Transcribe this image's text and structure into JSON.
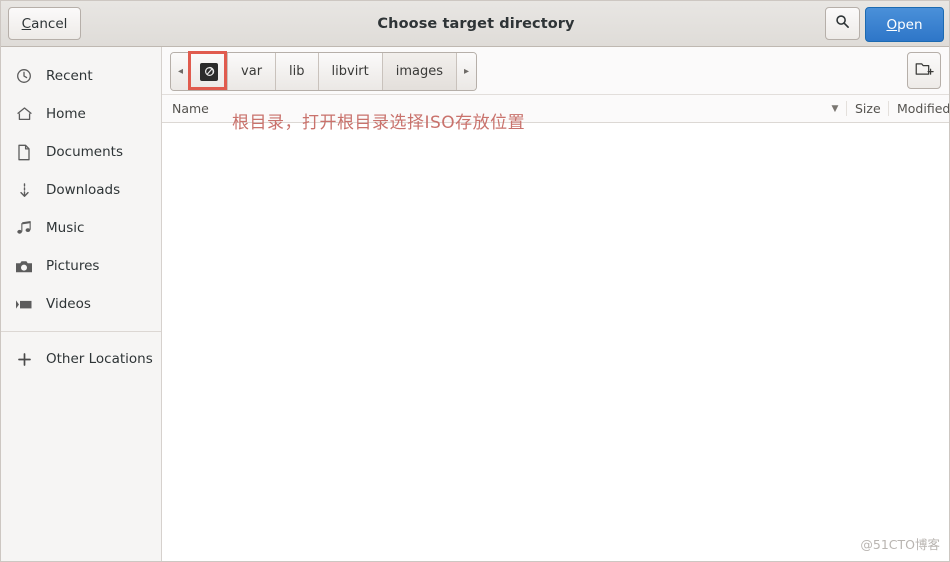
{
  "window": {
    "title": "Choose target directory"
  },
  "header": {
    "cancel_label": "Cancel",
    "cancel_accel": "C",
    "cancel_rest": "ancel",
    "open_label": "Open",
    "open_accel": "O",
    "open_rest": "pen",
    "search_icon": "search-icon"
  },
  "sidebar": {
    "items": [
      {
        "label": "Recent",
        "icon": "clock-icon"
      },
      {
        "label": "Home",
        "icon": "home-icon"
      },
      {
        "label": "Documents",
        "icon": "document-icon"
      },
      {
        "label": "Downloads",
        "icon": "download-icon"
      },
      {
        "label": "Music",
        "icon": "music-note-icon"
      },
      {
        "label": "Pictures",
        "icon": "camera-icon"
      },
      {
        "label": "Videos",
        "icon": "video-icon"
      }
    ],
    "other_locations": {
      "label": "Other Locations",
      "icon": "plus-icon"
    }
  },
  "pathbar": {
    "prev_arrow": "◂",
    "next_arrow": "▸",
    "root_icon": "filesystem-root-icon",
    "crumbs": [
      "var",
      "lib",
      "libvirt",
      "images"
    ],
    "new_folder_icon": "new-folder-icon"
  },
  "columns": {
    "name": "Name",
    "sort_arrow": "▼",
    "size": "Size",
    "modified": "Modified"
  },
  "annotation": {
    "text": "根目录，打开根目录选择ISO存放位置",
    "color": "#c9726c"
  },
  "watermark": {
    "text": "@51CTO博客"
  },
  "colors": {
    "accent": "#3584e4",
    "open_button": "#3a80d2",
    "sidebar_bg": "#f6f5f4",
    "annotation_red": "#c9726c",
    "highlight_box": "#e05b4e"
  }
}
